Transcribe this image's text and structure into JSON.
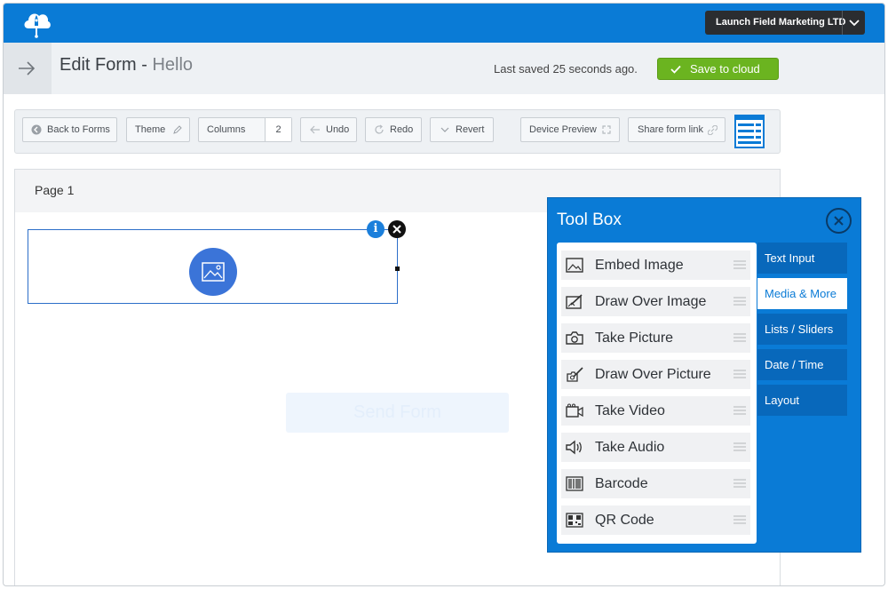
{
  "topbar": {
    "org_name": "Launch Field Marketing LTD"
  },
  "header": {
    "title": "Edit Form - ",
    "subtitle": "Hello",
    "saved_status": "Last saved 25 seconds ago.",
    "save_label": "Save to cloud"
  },
  "toolbar": {
    "back_label": "Back to Forms",
    "theme_label": "Theme",
    "columns_label": "Columns",
    "columns_value": "2",
    "undo_label": "Undo",
    "redo_label": "Redo",
    "revert_label": "Revert",
    "device_preview_label": "Device Preview",
    "share_label": "Share form link"
  },
  "page": {
    "title": "Page 1",
    "info_glyph": "i",
    "send_label": "Send Form"
  },
  "toolbox": {
    "title": "Tool Box",
    "tools": [
      {
        "label": "Embed Image",
        "icon": "image-icon"
      },
      {
        "label": "Draw Over Image",
        "icon": "draw-image-icon"
      },
      {
        "label": "Take Picture",
        "icon": "camera-icon"
      },
      {
        "label": "Draw Over Picture",
        "icon": "draw-picture-icon"
      },
      {
        "label": "Take Video",
        "icon": "video-icon"
      },
      {
        "label": "Take Audio",
        "icon": "audio-icon"
      },
      {
        "label": "Barcode",
        "icon": "barcode-icon"
      },
      {
        "label": "QR Code",
        "icon": "qr-code-icon"
      }
    ],
    "categories": [
      {
        "label": "Text Input",
        "active": false
      },
      {
        "label": "Media & More",
        "active": true
      },
      {
        "label": "Lists / Sliders",
        "active": false
      },
      {
        "label": "Date / Time",
        "active": false
      },
      {
        "label": "Layout",
        "active": false
      }
    ]
  },
  "colors": {
    "brand_blue": "#0a7bd6",
    "save_green": "#6bb420",
    "dark": "#2b2d30"
  }
}
